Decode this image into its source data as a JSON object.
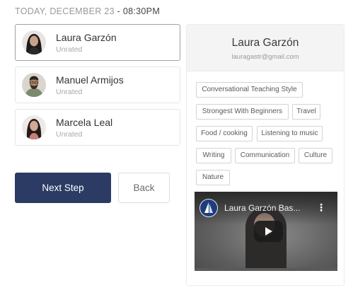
{
  "header": {
    "date_label": "TODAY, DECEMBER 23",
    "separator": "-",
    "time": "08:30PM"
  },
  "tutors": [
    {
      "name": "Laura Garzón",
      "status": "Unrated",
      "selected": true
    },
    {
      "name": "Manuel Armijos",
      "status": "Unrated",
      "selected": false
    },
    {
      "name": "Marcela Leal",
      "status": "Unrated",
      "selected": false
    }
  ],
  "actions": {
    "next_label": "Next Step",
    "back_label": "Back"
  },
  "profile": {
    "name": "Laura Garzón",
    "email": "lauragastr@gmail.com",
    "tags": [
      "Conversational Teaching Style",
      "Strongest With Beginners",
      "Travel",
      "Food / cooking",
      "Listening to music",
      "Writing",
      "Communication",
      "Culture",
      "Nature"
    ],
    "video": {
      "title": "Laura Garzón Bas...",
      "menu_icon": "more-vertical-icon",
      "play_icon": "play-icon"
    }
  },
  "colors": {
    "primary": "#2b3b63",
    "panel_header": "#f4f4f4",
    "muted_text": "#9a9a9a"
  }
}
